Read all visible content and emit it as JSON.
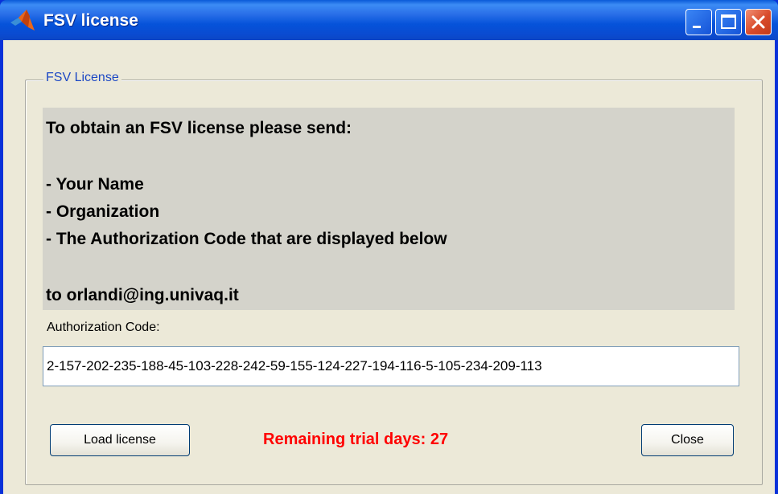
{
  "window": {
    "title": "FSV license",
    "app_icon": "matlab-logo-icon",
    "controls": [
      "minimize-icon",
      "maximize-icon",
      "close-icon"
    ]
  },
  "group": {
    "label": "FSV License"
  },
  "info": {
    "lines": [
      "To obtain an FSV license please send:",
      "- Your Name",
      "- Organization",
      "- The Authorization Code that are displayed below",
      "to orlandi@ing.univaq.it"
    ]
  },
  "auth": {
    "label": "Authorization Code:",
    "value": "2-157-202-235-188-45-103-228-242-59-155-124-227-194-116-5-105-234-209-113"
  },
  "buttons": {
    "load": "Load license",
    "close": "Close"
  },
  "status": {
    "trial_text": "Remaining trial days: 27",
    "trial_color": "#ff0000"
  },
  "colors": {
    "titlebar": "#0a4bd1",
    "dialog_bg": "#ece9d8",
    "legend": "#1c48c4",
    "info_bg": "#d4d3cb"
  }
}
